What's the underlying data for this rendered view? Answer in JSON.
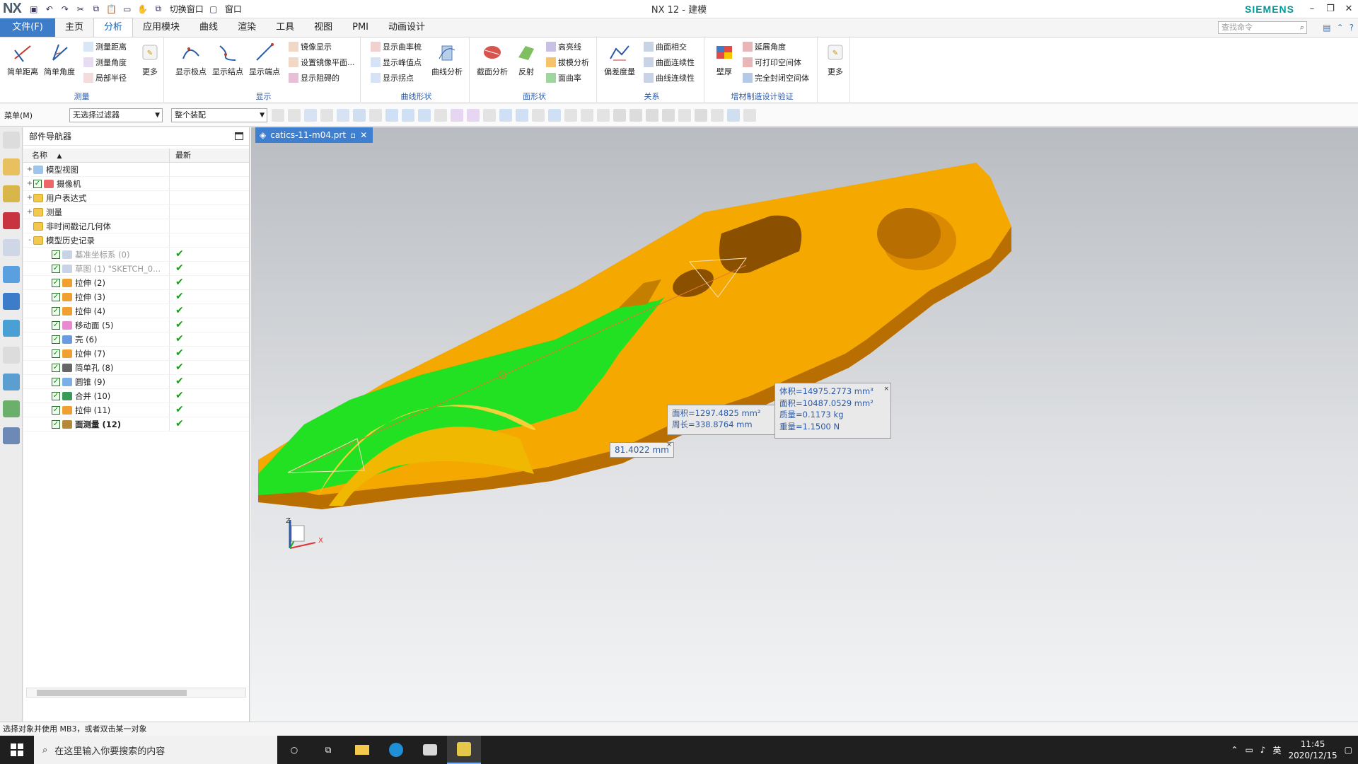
{
  "titlebar": {
    "logo": "NX",
    "switch_window": "切换窗口",
    "window": "窗口",
    "title": "NX 12 - 建模",
    "brand": "SIEMENS"
  },
  "menu": {
    "file": "文件(F)",
    "tabs": [
      "主页",
      "分析",
      "应用模块",
      "曲线",
      "渲染",
      "工具",
      "视图",
      "PMI",
      "动画设计"
    ],
    "active": "分析",
    "search_placeholder": "查找命令"
  },
  "ribbon": {
    "measure": {
      "label": "测量",
      "big": [
        "简单距离",
        "简单角度"
      ],
      "small": [
        "测量距离",
        "测量角度",
        "局部半径"
      ],
      "more": "更多"
    },
    "display": {
      "label": "显示",
      "big": [
        "显示极点",
        "显示结点",
        "显示端点"
      ],
      "small": [
        "镜像显示",
        "设置镜像平面...",
        "显示阻碍的"
      ]
    },
    "curve_shape": {
      "label": "曲线形状",
      "small": [
        "显示曲率梳",
        "显示峰值点",
        "显示拐点"
      ],
      "big": [
        "曲线分析"
      ]
    },
    "face_shape": {
      "label": "面形状",
      "big": [
        "截面分析",
        "反射"
      ],
      "small": [
        "高亮线",
        "拔模分析",
        "面曲率"
      ]
    },
    "relation": {
      "label": "关系",
      "big": [
        "偏差度量"
      ],
      "small": [
        "曲面相交",
        "曲面连续性",
        "曲线连续性"
      ]
    },
    "additive": {
      "label": "增材制造设计验证",
      "big": [
        "壁厚"
      ],
      "small": [
        "延展角度",
        "可打印空间体",
        "完全封闭空间体"
      ]
    },
    "more2": "更多"
  },
  "toolbar": {
    "menu": "菜单(M)",
    "filter": "无选择过滤器",
    "assembly": "整个装配"
  },
  "navigator": {
    "title": "部件导航器",
    "col_name": "名称",
    "col_latest": "最新",
    "rows": [
      {
        "exp": "+",
        "name": "模型视图",
        "type": "view",
        "check": false,
        "latest": ""
      },
      {
        "exp": "+",
        "name": "摄像机",
        "type": "camera",
        "check": true,
        "latest": ""
      },
      {
        "exp": "+",
        "name": "用户表达式",
        "type": "folder",
        "check": false,
        "latest": ""
      },
      {
        "exp": "+",
        "name": "测量",
        "type": "folder",
        "check": false,
        "latest": ""
      },
      {
        "exp": "",
        "name": "非时间戳记几何体",
        "type": "folder",
        "check": false,
        "latest": ""
      },
      {
        "exp": "-",
        "name": "模型历史记录",
        "type": "folder",
        "check": false,
        "latest": ""
      },
      {
        "exp": "",
        "name": "基准坐标系 (0)",
        "type": "datum",
        "check": true,
        "latest": "✔",
        "grey": true
      },
      {
        "exp": "",
        "name": "草图 (1) \"SKETCH_0...",
        "type": "sketch",
        "check": true,
        "latest": "✔",
        "grey": true
      },
      {
        "exp": "",
        "name": "拉伸 (2)",
        "type": "extrude",
        "check": true,
        "latest": "✔"
      },
      {
        "exp": "",
        "name": "拉伸 (3)",
        "type": "extrude",
        "check": true,
        "latest": "✔"
      },
      {
        "exp": "",
        "name": "拉伸 (4)",
        "type": "extrude",
        "check": true,
        "latest": "✔"
      },
      {
        "exp": "",
        "name": "移动面 (5)",
        "type": "move",
        "check": true,
        "latest": "✔"
      },
      {
        "exp": "",
        "name": "壳 (6)",
        "type": "shell",
        "check": true,
        "latest": "✔"
      },
      {
        "exp": "",
        "name": "拉伸 (7)",
        "type": "extrude",
        "check": true,
        "latest": "✔"
      },
      {
        "exp": "",
        "name": "简单孔 (8)",
        "type": "hole",
        "check": true,
        "latest": "✔"
      },
      {
        "exp": "",
        "name": "圆锥 (9)",
        "type": "cone",
        "check": true,
        "latest": "✔"
      },
      {
        "exp": "",
        "name": "合并 (10)",
        "type": "unite",
        "check": true,
        "latest": "✔"
      },
      {
        "exp": "",
        "name": "拉伸 (11)",
        "type": "extrude",
        "check": true,
        "latest": "✔"
      },
      {
        "exp": "",
        "name": "面测量 (12)",
        "type": "measure",
        "check": true,
        "latest": "✔",
        "bold": true
      }
    ]
  },
  "doc_tab": "catics-11-m04.prt",
  "annotations": {
    "distance": "81.4022 mm",
    "area_box": [
      "面积=1297.4825 mm²",
      "周长=338.8764 mm"
    ],
    "mass_box": [
      "体积=14975.2773 mm³",
      "面积=10487.0529 mm²",
      "质量=0.1173 kg",
      "重量=1.1500 N"
    ]
  },
  "status": "选择对象并使用 MB3，或者双击某一对象",
  "taskbar": {
    "search": "在这里输入你要搜索的内容",
    "ime": "英",
    "time": "11:45",
    "date": "2020/12/15"
  },
  "colors": {
    "file_tab": "#3d7cc9",
    "part_orange": "#f5a800",
    "part_face_green": "#22e022",
    "brand": "#009999",
    "label_blue": "#2b5aa8"
  }
}
